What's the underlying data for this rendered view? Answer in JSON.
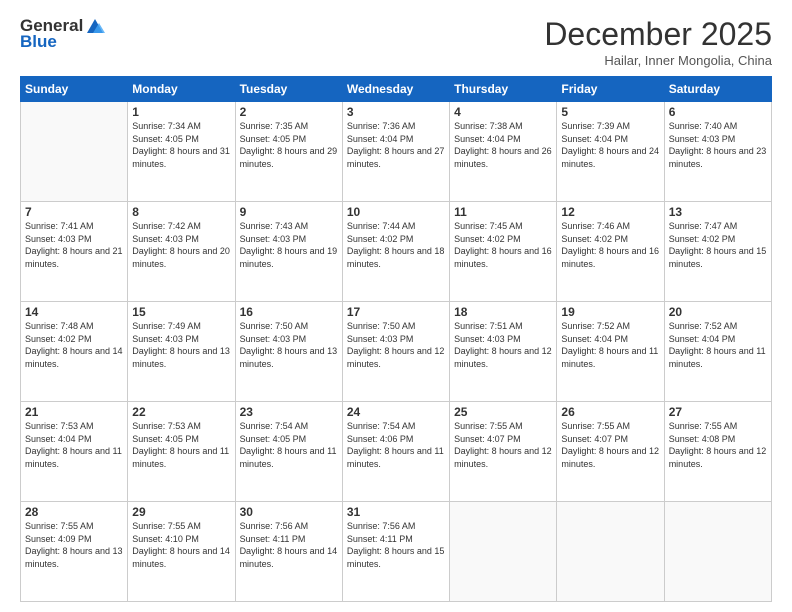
{
  "logo": {
    "general": "General",
    "blue": "Blue"
  },
  "header": {
    "month": "December 2025",
    "location": "Hailar, Inner Mongolia, China"
  },
  "weekdays": [
    "Sunday",
    "Monday",
    "Tuesday",
    "Wednesday",
    "Thursday",
    "Friday",
    "Saturday"
  ],
  "weeks": [
    [
      {
        "day": "",
        "sunrise": "",
        "sunset": "",
        "daylight": ""
      },
      {
        "day": "1",
        "sunrise": "7:34 AM",
        "sunset": "4:05 PM",
        "daylight": "8 hours and 31 minutes."
      },
      {
        "day": "2",
        "sunrise": "7:35 AM",
        "sunset": "4:05 PM",
        "daylight": "8 hours and 29 minutes."
      },
      {
        "day": "3",
        "sunrise": "7:36 AM",
        "sunset": "4:04 PM",
        "daylight": "8 hours and 27 minutes."
      },
      {
        "day": "4",
        "sunrise": "7:38 AM",
        "sunset": "4:04 PM",
        "daylight": "8 hours and 26 minutes."
      },
      {
        "day": "5",
        "sunrise": "7:39 AM",
        "sunset": "4:04 PM",
        "daylight": "8 hours and 24 minutes."
      },
      {
        "day": "6",
        "sunrise": "7:40 AM",
        "sunset": "4:03 PM",
        "daylight": "8 hours and 23 minutes."
      }
    ],
    [
      {
        "day": "7",
        "sunrise": "7:41 AM",
        "sunset": "4:03 PM",
        "daylight": "8 hours and 21 minutes."
      },
      {
        "day": "8",
        "sunrise": "7:42 AM",
        "sunset": "4:03 PM",
        "daylight": "8 hours and 20 minutes."
      },
      {
        "day": "9",
        "sunrise": "7:43 AM",
        "sunset": "4:03 PM",
        "daylight": "8 hours and 19 minutes."
      },
      {
        "day": "10",
        "sunrise": "7:44 AM",
        "sunset": "4:02 PM",
        "daylight": "8 hours and 18 minutes."
      },
      {
        "day": "11",
        "sunrise": "7:45 AM",
        "sunset": "4:02 PM",
        "daylight": "8 hours and 16 minutes."
      },
      {
        "day": "12",
        "sunrise": "7:46 AM",
        "sunset": "4:02 PM",
        "daylight": "8 hours and 16 minutes."
      },
      {
        "day": "13",
        "sunrise": "7:47 AM",
        "sunset": "4:02 PM",
        "daylight": "8 hours and 15 minutes."
      }
    ],
    [
      {
        "day": "14",
        "sunrise": "7:48 AM",
        "sunset": "4:02 PM",
        "daylight": "8 hours and 14 minutes."
      },
      {
        "day": "15",
        "sunrise": "7:49 AM",
        "sunset": "4:03 PM",
        "daylight": "8 hours and 13 minutes."
      },
      {
        "day": "16",
        "sunrise": "7:50 AM",
        "sunset": "4:03 PM",
        "daylight": "8 hours and 13 minutes."
      },
      {
        "day": "17",
        "sunrise": "7:50 AM",
        "sunset": "4:03 PM",
        "daylight": "8 hours and 12 minutes."
      },
      {
        "day": "18",
        "sunrise": "7:51 AM",
        "sunset": "4:03 PM",
        "daylight": "8 hours and 12 minutes."
      },
      {
        "day": "19",
        "sunrise": "7:52 AM",
        "sunset": "4:04 PM",
        "daylight": "8 hours and 11 minutes."
      },
      {
        "day": "20",
        "sunrise": "7:52 AM",
        "sunset": "4:04 PM",
        "daylight": "8 hours and 11 minutes."
      }
    ],
    [
      {
        "day": "21",
        "sunrise": "7:53 AM",
        "sunset": "4:04 PM",
        "daylight": "8 hours and 11 minutes."
      },
      {
        "day": "22",
        "sunrise": "7:53 AM",
        "sunset": "4:05 PM",
        "daylight": "8 hours and 11 minutes."
      },
      {
        "day": "23",
        "sunrise": "7:54 AM",
        "sunset": "4:05 PM",
        "daylight": "8 hours and 11 minutes."
      },
      {
        "day": "24",
        "sunrise": "7:54 AM",
        "sunset": "4:06 PM",
        "daylight": "8 hours and 11 minutes."
      },
      {
        "day": "25",
        "sunrise": "7:55 AM",
        "sunset": "4:07 PM",
        "daylight": "8 hours and 12 minutes."
      },
      {
        "day": "26",
        "sunrise": "7:55 AM",
        "sunset": "4:07 PM",
        "daylight": "8 hours and 12 minutes."
      },
      {
        "day": "27",
        "sunrise": "7:55 AM",
        "sunset": "4:08 PM",
        "daylight": "8 hours and 12 minutes."
      }
    ],
    [
      {
        "day": "28",
        "sunrise": "7:55 AM",
        "sunset": "4:09 PM",
        "daylight": "8 hours and 13 minutes."
      },
      {
        "day": "29",
        "sunrise": "7:55 AM",
        "sunset": "4:10 PM",
        "daylight": "8 hours and 14 minutes."
      },
      {
        "day": "30",
        "sunrise": "7:56 AM",
        "sunset": "4:11 PM",
        "daylight": "8 hours and 14 minutes."
      },
      {
        "day": "31",
        "sunrise": "7:56 AM",
        "sunset": "4:11 PM",
        "daylight": "8 hours and 15 minutes."
      },
      {
        "day": "",
        "sunrise": "",
        "sunset": "",
        "daylight": ""
      },
      {
        "day": "",
        "sunrise": "",
        "sunset": "",
        "daylight": ""
      },
      {
        "day": "",
        "sunrise": "",
        "sunset": "",
        "daylight": ""
      }
    ]
  ],
  "labels": {
    "sunrise": "Sunrise:",
    "sunset": "Sunset:",
    "daylight": "Daylight:"
  }
}
